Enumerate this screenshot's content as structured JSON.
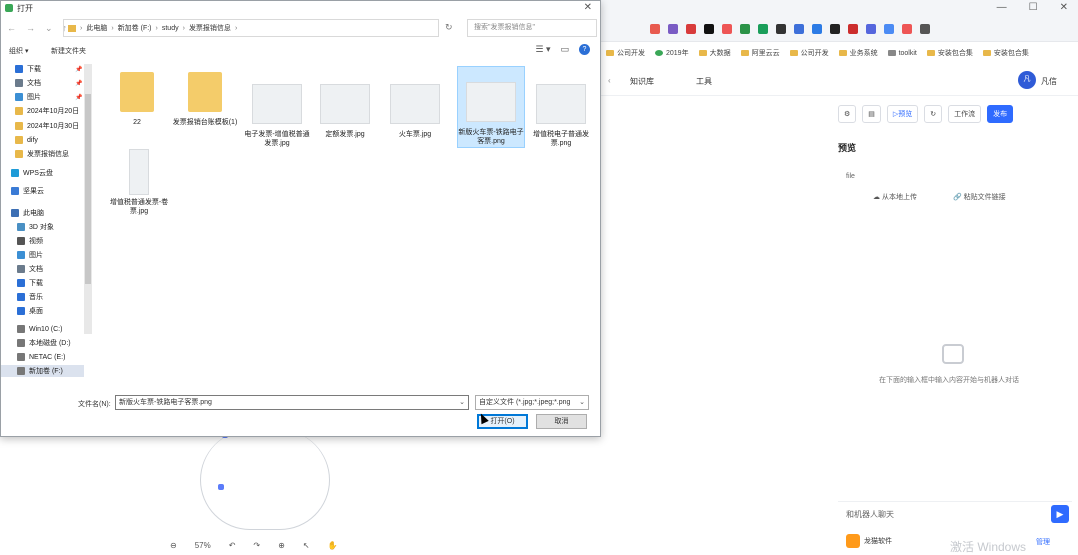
{
  "dialog": {
    "title": "打开",
    "breadcrumb": [
      "此电脑",
      "新加卷 (F:)",
      "study",
      "发票报销信息"
    ],
    "search_placeholder": "搜索\"发票报销信息\"",
    "organize": "组织 ▾",
    "new_folder": "新建文件夹",
    "nav": [
      {
        "label": "下载",
        "icon": "download-icon",
        "pinned": true
      },
      {
        "label": "文档",
        "icon": "document-icon",
        "pinned": true
      },
      {
        "label": "图片",
        "icon": "picture-icon",
        "pinned": true
      },
      {
        "label": "2024年10月20日",
        "icon": "folder-icon",
        "pinned": false
      },
      {
        "label": "2024年10月30日",
        "icon": "folder-icon",
        "pinned": false
      },
      {
        "label": "dify",
        "icon": "folder-icon",
        "pinned": false
      },
      {
        "label": "发票报销信息",
        "icon": "folder-icon",
        "pinned": false
      },
      {
        "label": "WPS云盘",
        "icon": "cloud-icon",
        "pinned": false
      },
      {
        "label": "坚果云",
        "icon": "nut-cloud-icon",
        "pinned": false
      },
      {
        "label": "此电脑",
        "icon": "computer-icon",
        "pinned": false
      },
      {
        "label": "3D 对象",
        "icon": "cube-icon",
        "pinned": false
      },
      {
        "label": "视频",
        "icon": "video-icon",
        "pinned": false
      },
      {
        "label": "图片",
        "icon": "picture-icon",
        "pinned": false
      },
      {
        "label": "文档",
        "icon": "document-icon",
        "pinned": false
      },
      {
        "label": "下载",
        "icon": "download-icon",
        "pinned": false
      },
      {
        "label": "音乐",
        "icon": "music-icon",
        "pinned": false
      },
      {
        "label": "桌面",
        "icon": "desktop-icon",
        "pinned": false
      },
      {
        "label": "Win10 (C:)",
        "icon": "drive-icon",
        "pinned": false
      },
      {
        "label": "本地磁盘 (D:)",
        "icon": "drive-icon",
        "pinned": false
      },
      {
        "label": "NETAC (E:)",
        "icon": "drive-icon",
        "pinned": false
      },
      {
        "label": "新加卷 (F:)",
        "icon": "drive-icon",
        "pinned": false
      }
    ],
    "files": [
      {
        "name": "22",
        "kind": "folder"
      },
      {
        "name": "发票报销台账模板(1)",
        "kind": "folder"
      },
      {
        "name": "电子发票-增值税普通发票.jpg",
        "kind": "image"
      },
      {
        "name": "定额发票.jpg",
        "kind": "image"
      },
      {
        "name": "火车票.jpg",
        "kind": "image"
      },
      {
        "name": "新版火车票-铁路电子客票.png",
        "kind": "image"
      },
      {
        "name": "增值税电子普通发票.png",
        "kind": "image"
      },
      {
        "name": "增值税普通发票-卷票.jpg",
        "kind": "image"
      }
    ],
    "filename_label": "文件名(N):",
    "filename_value": "新版火车票-铁路电子客票.png",
    "filetype_value": "自定义文件 (*.jpg;*.jpeg;*.png",
    "open_label": "打开(O)",
    "cancel_label": "取消"
  },
  "browser": {
    "bookmarks": [
      "公司开发",
      "2019年",
      "大数据",
      "阿里云云",
      "公司开发",
      "业务系统",
      "toolkit",
      "安装包合集",
      "安装包合集"
    ]
  },
  "app": {
    "toolbar_items": [
      "知识库",
      "工具"
    ],
    "user": "凡信",
    "buttons": [
      "预览",
      "发布",
      "工作流"
    ],
    "publish_label": "发布",
    "preview_title": "预览",
    "file_label": "file",
    "upload_local": "从本地上传",
    "paste_link": "粘贴文件链接",
    "robot_hint": "在下面的输入框中输入内容开始与机器人对话",
    "chat_placeholder": "和机器人聊天",
    "bottom_app": "龙猫软件",
    "activate": "激活 Windows",
    "corner_link": "管理",
    "zoom": "57%"
  }
}
